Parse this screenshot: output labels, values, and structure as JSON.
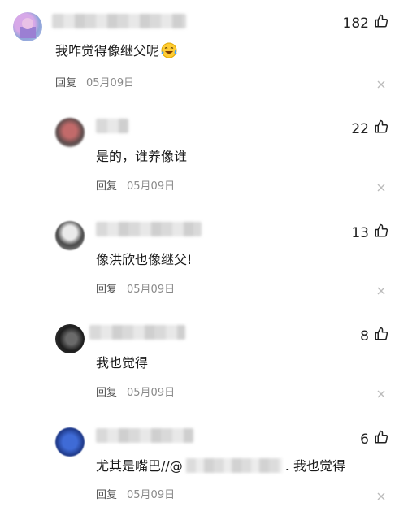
{
  "comments": [
    {
      "text": "我咋觉得像继父呢",
      "emoji_icon": "crying-laughing-emoji-icon",
      "reply_label": "回复",
      "date": "05月09日",
      "likes": "182",
      "level": 0
    },
    {
      "text": "是的，谁养像谁",
      "reply_label": "回复",
      "date": "05月09日",
      "likes": "22",
      "level": 1
    },
    {
      "text": "像洪欣也像继父!",
      "reply_label": "回复",
      "date": "05月09日",
      "likes": "13",
      "level": 1
    },
    {
      "text": "我也觉得",
      "reply_label": "回复",
      "date": "05月09日",
      "likes": "8",
      "level": 1
    },
    {
      "text_before": "尤其是嘴巴//@",
      "text_after": ". 我也觉得",
      "reply_label": "回复",
      "date": "05月09日",
      "likes": "6",
      "level": 1
    }
  ],
  "icons": {
    "like": "thumbs-up-outline-icon",
    "dismiss": "close-icon"
  },
  "colors": {
    "text": "#1a1a1a",
    "meta": "#8a8a8a",
    "background": "#ffffff"
  }
}
